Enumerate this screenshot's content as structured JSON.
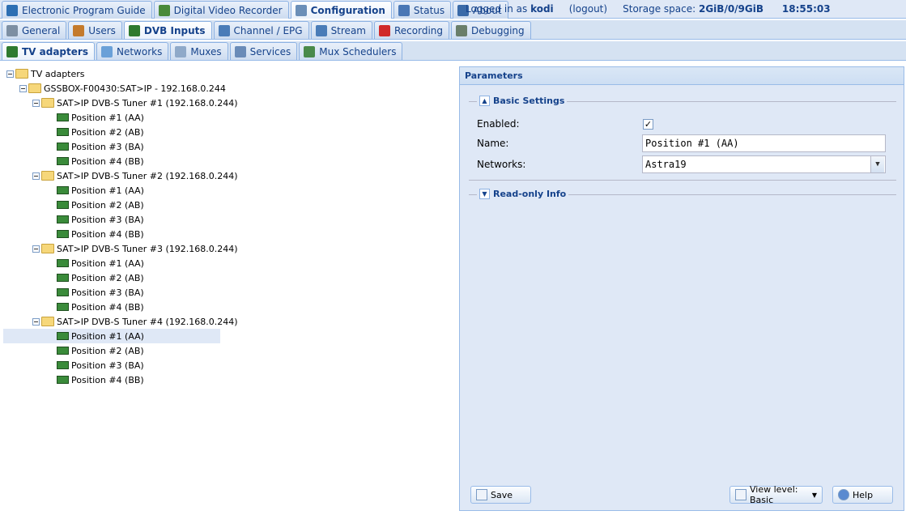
{
  "top_tabs": [
    {
      "label": "Electronic Program Guide",
      "icon": "epg-icon",
      "color": "#2d6fb3"
    },
    {
      "label": "Digital Video Recorder",
      "icon": "dvr-download-icon",
      "color": "#4a8a3a"
    },
    {
      "label": "Configuration",
      "icon": "wrench-icon",
      "color": "#6b8fb8",
      "active": true
    },
    {
      "label": "Status",
      "icon": "eye-icon",
      "color": "#4a77b5"
    },
    {
      "label": "About",
      "icon": "info-icon",
      "color": "#3a6aa8"
    }
  ],
  "status": {
    "logged_in_prefix": "Logged in as",
    "user": "kodi",
    "logout": "(logout)",
    "storage_label": "Storage space:",
    "storage_value": "2GiB/0/9GiB",
    "time": "18:55:03"
  },
  "second_tabs": [
    {
      "label": "General",
      "icon": "tools-icon",
      "color": "#7d8fa3"
    },
    {
      "label": "Users",
      "icon": "users-icon",
      "color": "#c47a2c"
    },
    {
      "label": "DVB Inputs",
      "icon": "dvb-card-icon",
      "color": "#2f7a2f",
      "active": true
    },
    {
      "label": "Channel / EPG",
      "icon": "tv-icon",
      "color": "#4a7cb8"
    },
    {
      "label": "Stream",
      "icon": "stream-icon",
      "color": "#4a7cb8"
    },
    {
      "label": "Recording",
      "icon": "rec-icon",
      "color": "#d02a2a"
    },
    {
      "label": "Debugging",
      "icon": "bug-icon",
      "color": "#6a7e6a"
    }
  ],
  "third_tabs": [
    {
      "label": "TV adapters",
      "icon": "tv-adapter-icon",
      "color": "#2f7a2f",
      "active": true
    },
    {
      "label": "Networks",
      "icon": "antenna-icon",
      "color": "#6aa0d8"
    },
    {
      "label": "Muxes",
      "icon": "mux-icon",
      "color": "#8fa9c9"
    },
    {
      "label": "Services",
      "icon": "services-icon",
      "color": "#6a8bb8"
    },
    {
      "label": "Mux Schedulers",
      "icon": "scheduler-icon",
      "color": "#4a8a4a"
    }
  ],
  "tree": {
    "root": "TV adapters",
    "device": "GSSBOX-F00430:SAT>IP - 192.168.0.244",
    "tuners": [
      {
        "label": "SAT>IP DVB-S Tuner #1 (192.168.0.244)",
        "positions": [
          "Position #1 (AA)",
          "Position #2 (AB)",
          "Position #3 (BA)",
          "Position #4 (BB)"
        ]
      },
      {
        "label": "SAT>IP DVB-S Tuner #2 (192.168.0.244)",
        "positions": [
          "Position #1 (AA)",
          "Position #2 (AB)",
          "Position #3 (BA)",
          "Position #4 (BB)"
        ]
      },
      {
        "label": "SAT>IP DVB-S Tuner #3 (192.168.0.244)",
        "positions": [
          "Position #1 (AA)",
          "Position #2 (AB)",
          "Position #3 (BA)",
          "Position #4 (BB)"
        ]
      },
      {
        "label": "SAT>IP DVB-S Tuner #4 (192.168.0.244)",
        "positions": [
          "Position #1 (AA)",
          "Position #2 (AB)",
          "Position #3 (BA)",
          "Position #4 (BB)"
        ]
      }
    ],
    "selected": "SAT>IP DVB-S Tuner #4 / Position #1 (AA)"
  },
  "params": {
    "title": "Parameters",
    "basic_settings": "Basic Settings",
    "enabled_label": "Enabled:",
    "enabled_checked": "✓",
    "name_label": "Name:",
    "name_value": "Position #1 (AA)",
    "networks_label": "Networks:",
    "networks_value": "Astra19",
    "readonly_info": "Read-only Info",
    "save": "Save",
    "view_level": "View level: Basic",
    "help": "Help"
  }
}
